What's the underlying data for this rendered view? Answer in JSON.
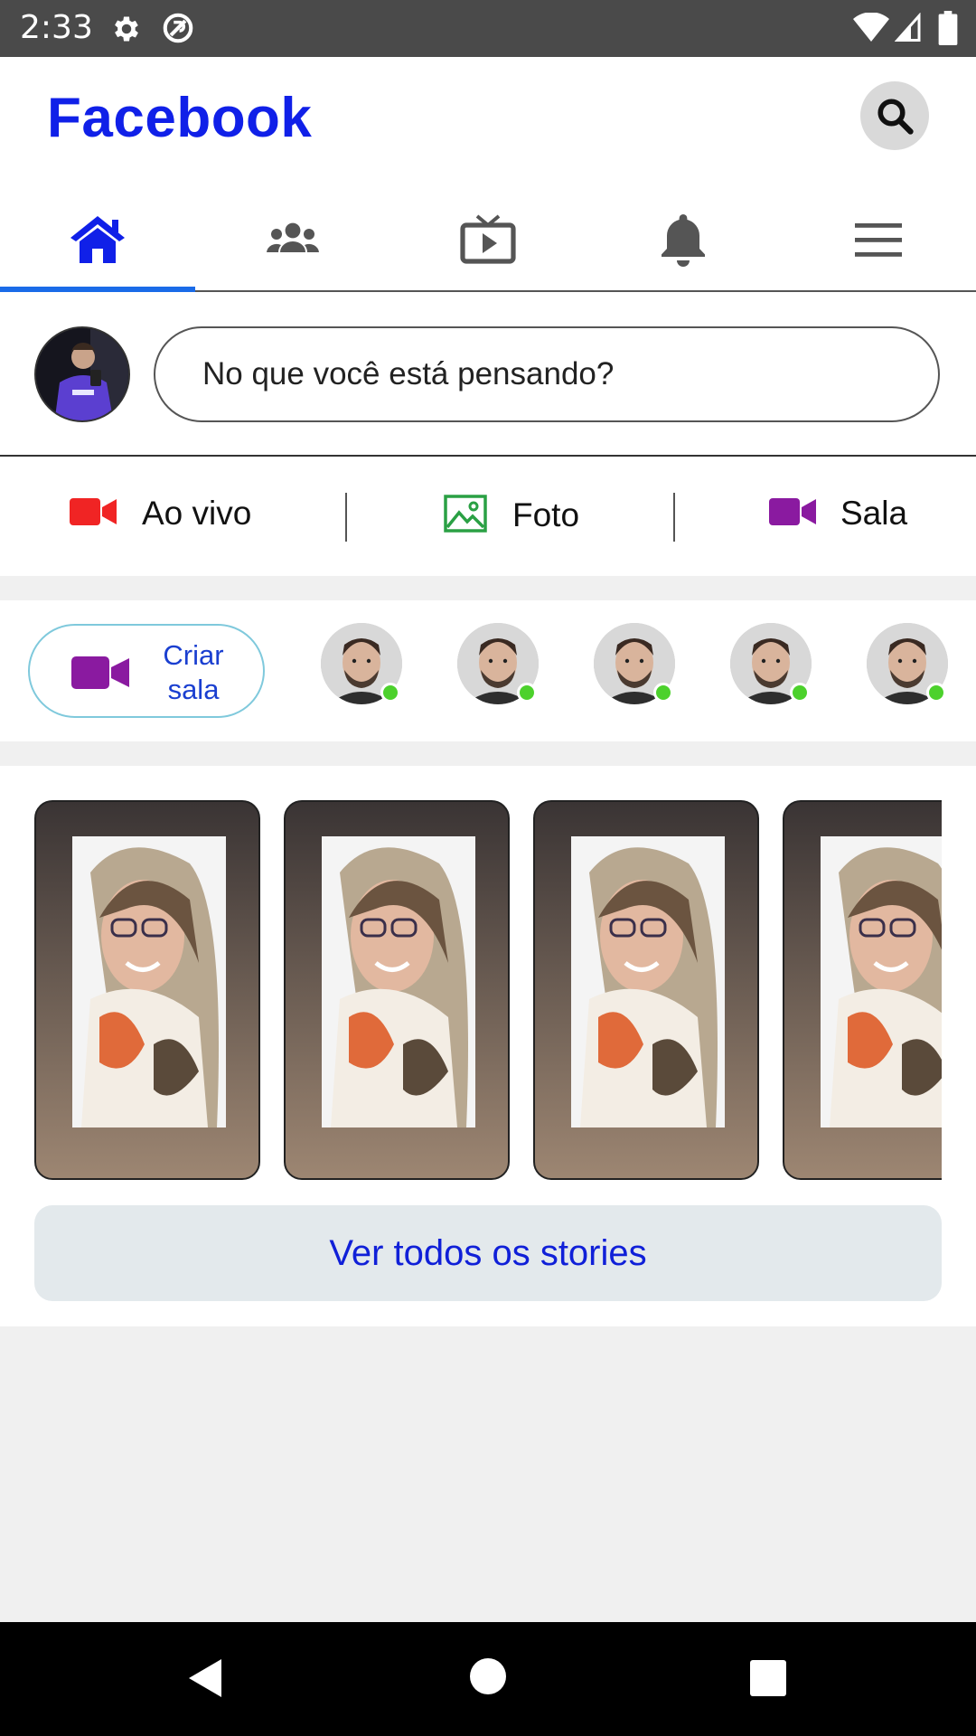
{
  "status_bar": {
    "time": "2:33"
  },
  "header": {
    "title": "Facebook"
  },
  "tabs": [
    {
      "name": "home",
      "active": true
    },
    {
      "name": "friends",
      "active": false
    },
    {
      "name": "watch",
      "active": false
    },
    {
      "name": "notifications",
      "active": false
    },
    {
      "name": "menu",
      "active": false
    }
  ],
  "composer": {
    "placeholder": "No que você está pensando?"
  },
  "actions": [
    {
      "label": "Ao vivo",
      "icon": "live-video-icon",
      "color": "#f02424"
    },
    {
      "label": "Foto",
      "icon": "photo-icon",
      "color": "#2aa044"
    },
    {
      "label": "Sala",
      "icon": "room-video-icon",
      "color": "#8a1aa0"
    }
  ],
  "rooms": {
    "create_label": "Criar sala",
    "create_color": "#8a1aa0"
  },
  "stories": {
    "see_all_label": "Ver todos os stories"
  },
  "colors": {
    "brand": "#1020e8",
    "tab_indicator": "#1a6be8",
    "online": "#4cd12c"
  }
}
